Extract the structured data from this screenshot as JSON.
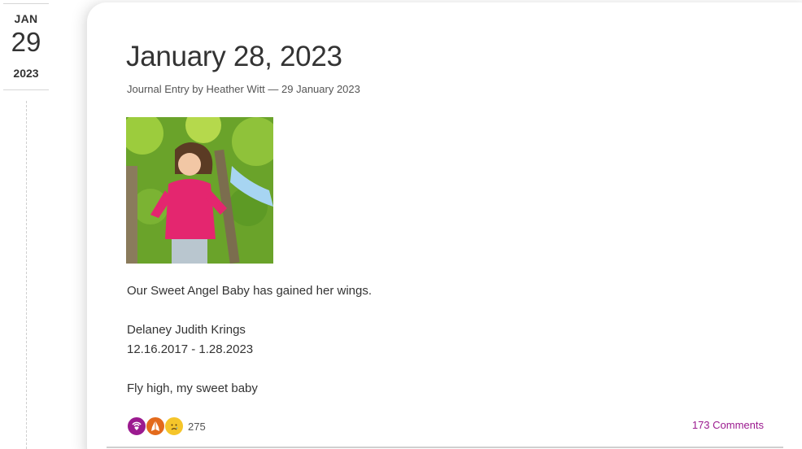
{
  "date_rail": {
    "month": "JAN",
    "day": "29",
    "year": "2023"
  },
  "entry": {
    "title": "January 28, 2023",
    "meta": "Journal Entry by Heather Witt — 29 January 2023",
    "photo_icon": "child-in-tree-photo",
    "body": [
      "Our Sweet Angel Baby has gained her wings.",
      "Delaney Judith Krings",
      "12.16.2017 - 1.28.2023",
      "Fly high, my sweet baby"
    ]
  },
  "reactions": {
    "icons": [
      "heart-signal-icon",
      "praying-hands-icon",
      "crying-face-icon"
    ],
    "count": "275"
  },
  "comments": {
    "label": "173 Comments"
  },
  "colors": {
    "accent": "#9b1a8f",
    "orange": "#e36a1c",
    "yellow": "#f5c52a"
  }
}
